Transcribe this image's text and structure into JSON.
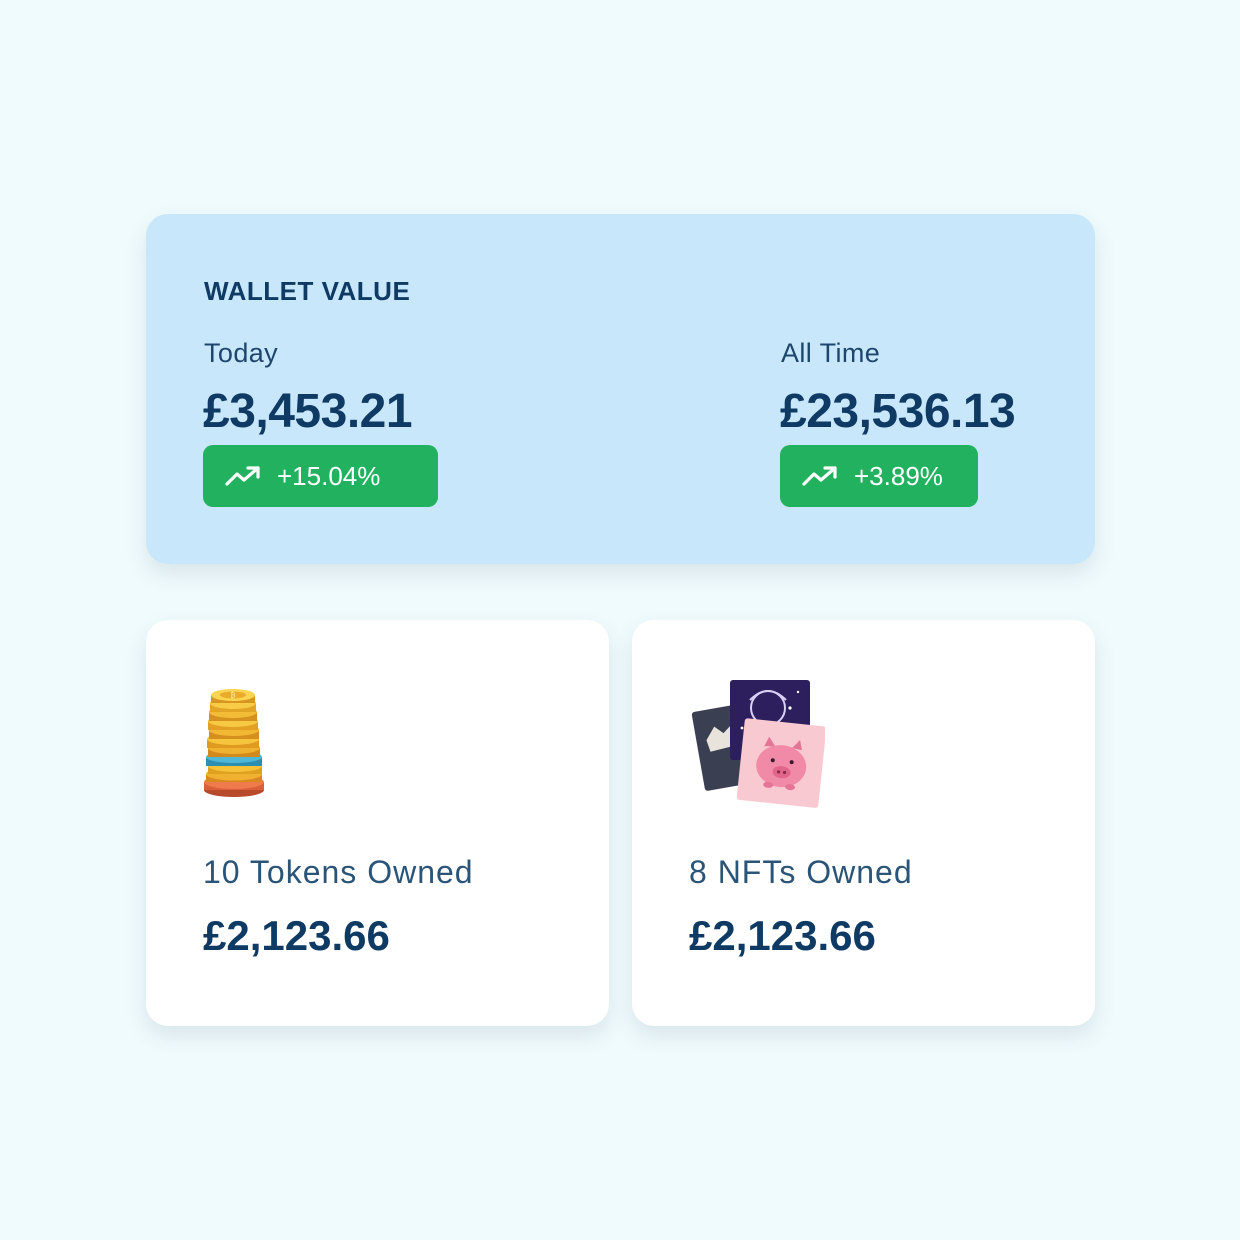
{
  "wallet": {
    "title": "WALLET VALUE",
    "today": {
      "label": "Today",
      "value": "£3,453.21",
      "change": "+15.04%"
    },
    "all_time": {
      "label": "All Time",
      "value": "£23,536.13",
      "change": "+3.89%"
    },
    "trend_icon": "trending-up-icon",
    "badge_color": "#22b15e"
  },
  "tokens": {
    "label": "10 Tokens Owned",
    "value": "£2,123.66",
    "icon": "coin-stack-icon"
  },
  "nfts": {
    "label": "8 NFTs Owned",
    "value": "£2,123.66",
    "icon": "nft-cards-icon"
  },
  "colors": {
    "background": "#f0fbfd",
    "wallet_card": "#c8e7fb",
    "text_primary": "#0f3a63",
    "positive": "#22b15e"
  }
}
